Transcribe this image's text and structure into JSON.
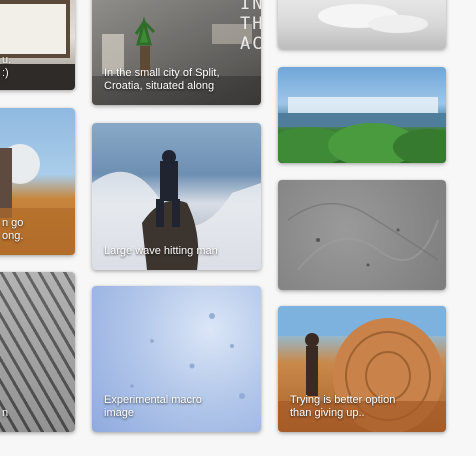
{
  "gallery": {
    "cards": [
      {
        "id": "chalkboard",
        "caption": "u.\n:)"
      },
      {
        "id": "split",
        "caption": "In the small city of Split,\nCroatia, situated along",
        "sign_text": "IN THE\nACE."
      },
      {
        "id": "snow",
        "caption": ""
      },
      {
        "id": "niagara",
        "caption": ""
      },
      {
        "id": "field",
        "caption": "n go\nong."
      },
      {
        "id": "wave",
        "caption": "Large wave hitting man"
      },
      {
        "id": "concrete",
        "caption": ""
      },
      {
        "id": "shingles",
        "caption": "n"
      },
      {
        "id": "macro",
        "caption": "Experimental macro\nimage"
      },
      {
        "id": "wood",
        "caption": "Trying is better option\nthan giving up.."
      }
    ]
  }
}
